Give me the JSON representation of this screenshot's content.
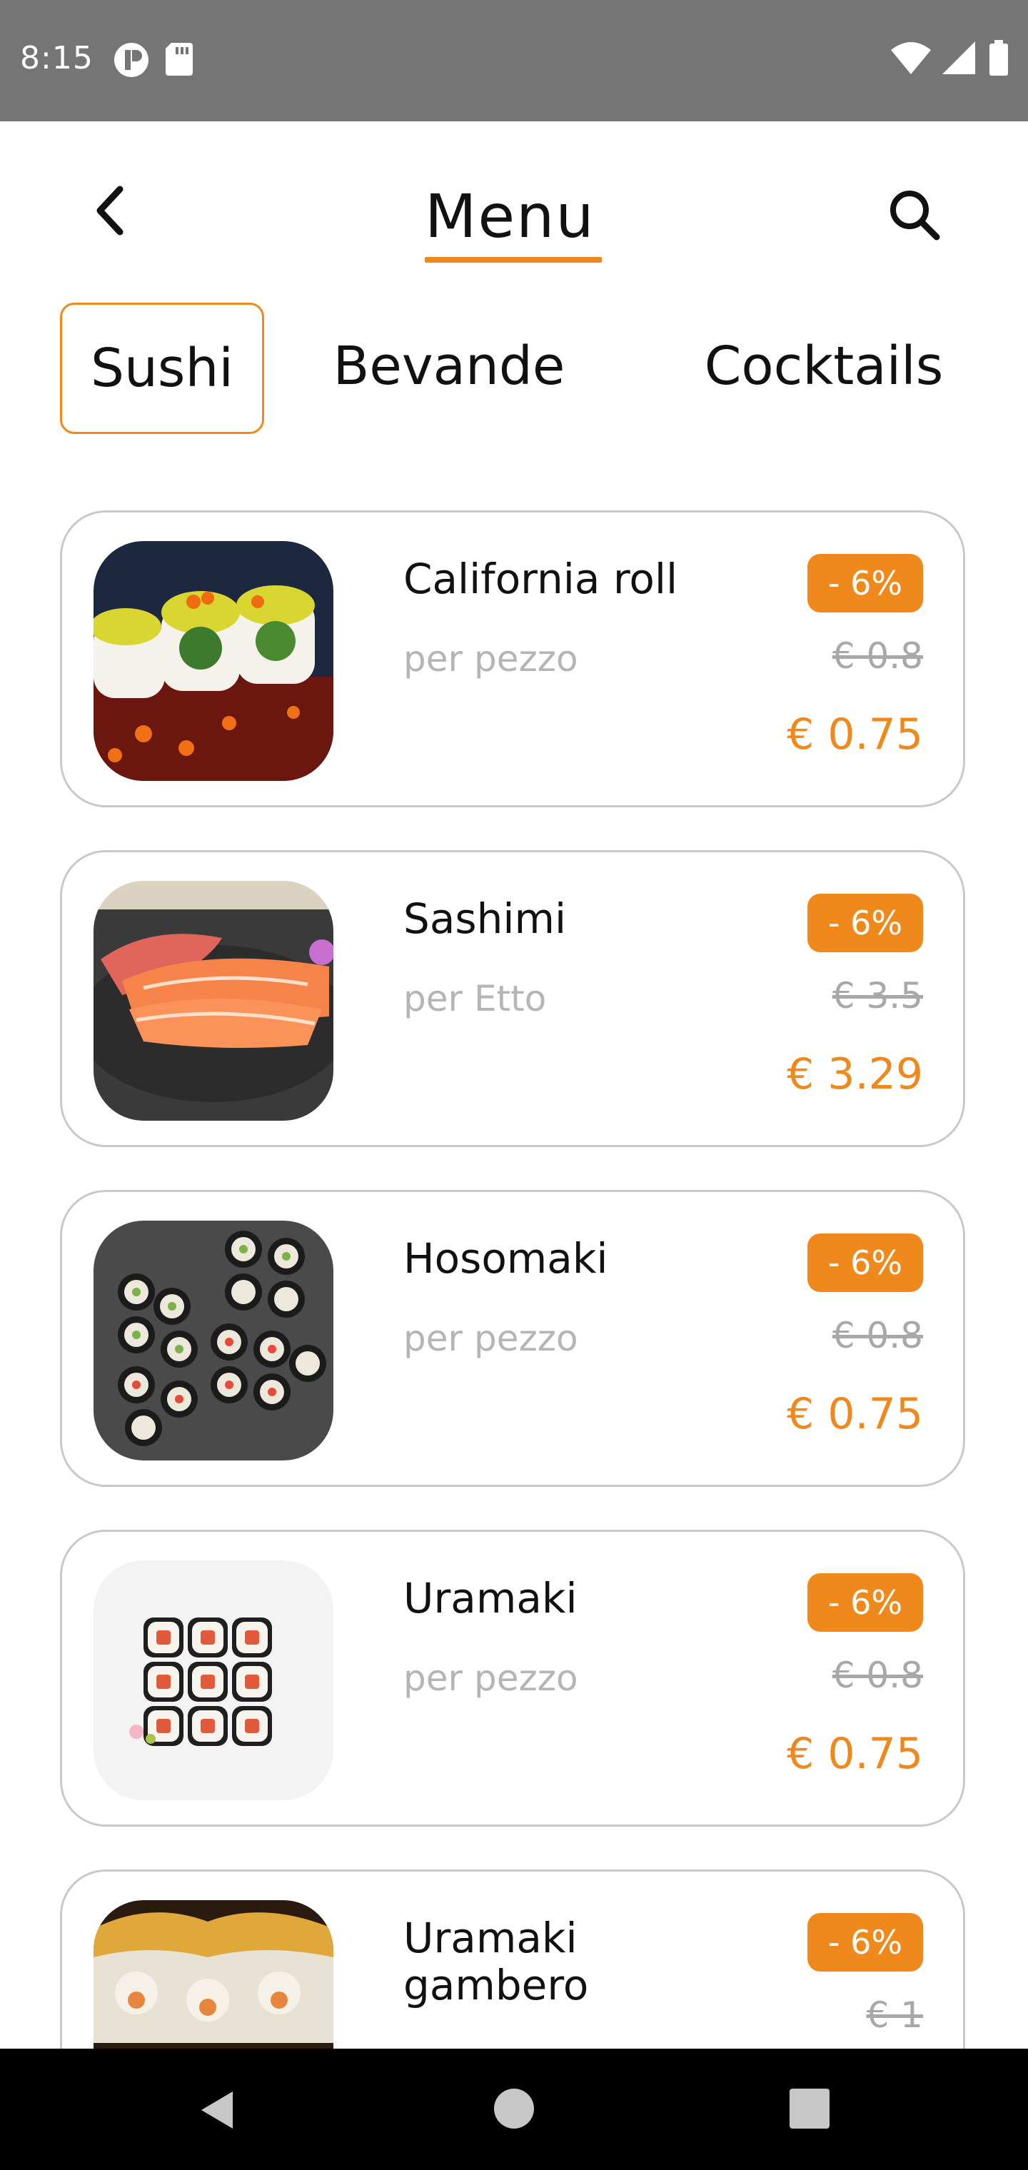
{
  "status": {
    "time": "8:15"
  },
  "header": {
    "title": "Menu"
  },
  "tabs": [
    {
      "label": "Sushi"
    },
    {
      "label": "Bevande"
    },
    {
      "label": "Cocktails"
    }
  ],
  "items": [
    {
      "name": "California roll",
      "unit": "per pezzo",
      "discount": "- 6%",
      "old_price": "€ 0.8",
      "price": "€ 0.75"
    },
    {
      "name": "Sashimi",
      "unit": "per Etto",
      "discount": "- 6%",
      "old_price": "€ 3.5",
      "price": "€ 3.29"
    },
    {
      "name": "Hosomaki",
      "unit": "per pezzo",
      "discount": "- 6%",
      "old_price": "€ 0.8",
      "price": "€ 0.75"
    },
    {
      "name": "Uramaki",
      "unit": "per pezzo",
      "discount": "- 6%",
      "old_price": "€ 0.8",
      "price": "€ 0.75"
    },
    {
      "name": "Uramaki gambero",
      "unit": "",
      "discount": "- 6%",
      "old_price": "€ 1",
      "price": ""
    }
  ],
  "colors": {
    "accent": "#f0891c",
    "border": "#c9c9c9"
  }
}
